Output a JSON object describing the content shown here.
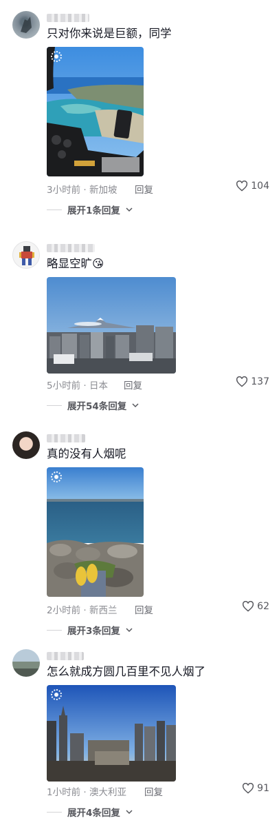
{
  "comments": [
    {
      "text": "只对你来说是巨额，同学",
      "meta": "3小时前 · 新加坡",
      "reply_label": "回复",
      "likes": "104",
      "expand_label": "展开1条回复"
    },
    {
      "text": "略显空旷😘",
      "meta": "5小时前 · 日本",
      "reply_label": "回复",
      "likes": "137",
      "expand_label": "展开54条回复"
    },
    {
      "text": "真的没有人烟呢",
      "meta": "2小时前 · 新西兰",
      "reply_label": "回复",
      "likes": "62",
      "expand_label": "展开3条回复"
    },
    {
      "text": "怎么就成方圆几百里不见人烟了",
      "meta": "1小时前 · 澳大利亚",
      "reply_label": "回复",
      "likes": "91",
      "expand_label": "展开4条回复"
    }
  ],
  "icons": {
    "like": "heart-outline-icon",
    "expand": "chevron-down-icon",
    "live": "live-photo-icon"
  },
  "colors": {
    "text": "#161823",
    "meta": "#8a8b91",
    "divider": "#d3d3d6"
  }
}
